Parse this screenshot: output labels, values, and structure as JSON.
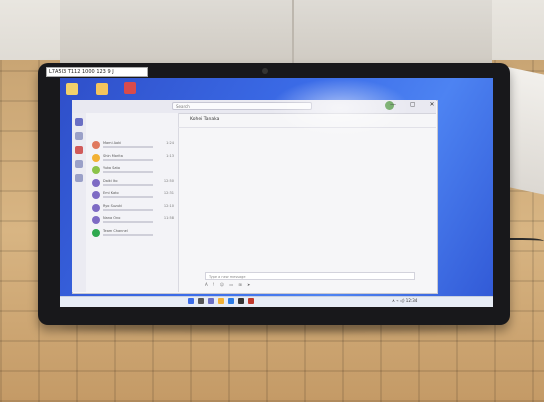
{
  "photo": {
    "sticker_text": "L7A5I3  T112 1000  123 9 J",
    "app": {
      "search_placeholder": "Search",
      "window_controls": "— ▢ ✕",
      "chat_title": "Kohei Tanaka",
      "compose_placeholder": "Type a new message",
      "compose_tools": "A ! ☺ ▭ ⊞ ➤",
      "chats": [
        {
          "name": "Mami Aoki",
          "time": "1:24",
          "color": "#e07a5f"
        },
        {
          "name": "Shin Morita",
          "time": "1:13",
          "color": "#f2b134"
        },
        {
          "name": "Yuka Sato",
          "time": "",
          "color": "#8bc34a"
        },
        {
          "name": "Daiki Ito",
          "time": "12:50",
          "color": "#7e6bc4"
        },
        {
          "name": "Emi Kato",
          "time": "12:31",
          "color": "#7e6bc4"
        },
        {
          "name": "Ryo Suzuki",
          "time": "12:10",
          "color": "#7e6bc4"
        },
        {
          "name": "Nana Ono",
          "time": "11:58",
          "color": "#7e6bc4"
        },
        {
          "name": "Team Channel",
          "time": "",
          "color": "#2fa84f"
        }
      ]
    },
    "tray_text": "∧ ⌁ ◁) 12:34",
    "colors": {
      "screen_blue": "#3b6ce8",
      "bezel": "#18181b",
      "floor": "#c9a574"
    }
  }
}
